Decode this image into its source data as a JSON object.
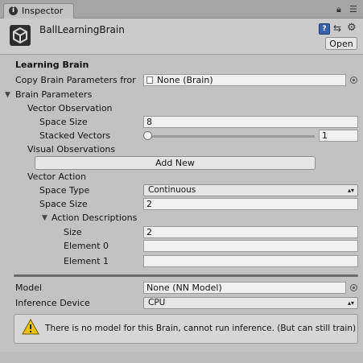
{
  "tab": {
    "label": "Inspector"
  },
  "header": {
    "title": "BallLearningBrain",
    "open_label": "Open"
  },
  "learning_brain": {
    "heading": "Learning Brain",
    "copy_params_label": "Copy Brain Parameters fror",
    "copy_params_value": "None (Brain)"
  },
  "brain_parameters": {
    "label": "Brain Parameters",
    "vector_observation": {
      "label": "Vector Observation",
      "space_size_label": "Space Size",
      "space_size_value": "8",
      "stacked_vectors_label": "Stacked Vectors",
      "stacked_vectors_value": "1",
      "stacked_vectors_slider_fraction": 0
    },
    "visual_observations": {
      "label": "Visual Observations",
      "add_new_label": "Add New"
    },
    "vector_action": {
      "label": "Vector Action",
      "space_type_label": "Space Type",
      "space_type_value": "Continuous",
      "space_size_label": "Space Size",
      "space_size_value": "2",
      "action_descriptions": {
        "label": "Action Descriptions",
        "size_label": "Size",
        "size_value": "2",
        "elements": [
          {
            "label": "Element 0",
            "value": ""
          },
          {
            "label": "Element 1",
            "value": ""
          }
        ]
      }
    }
  },
  "model": {
    "label": "Model",
    "value": "None (NN Model)"
  },
  "inference": {
    "label": "Inference Device",
    "value": "CPU"
  },
  "warning": {
    "text": "There is no model for this Brain, cannot run inference. (But can still train)"
  },
  "colors": {
    "accent_help": "#3a62a8",
    "warning_yellow": "#f2c200"
  }
}
